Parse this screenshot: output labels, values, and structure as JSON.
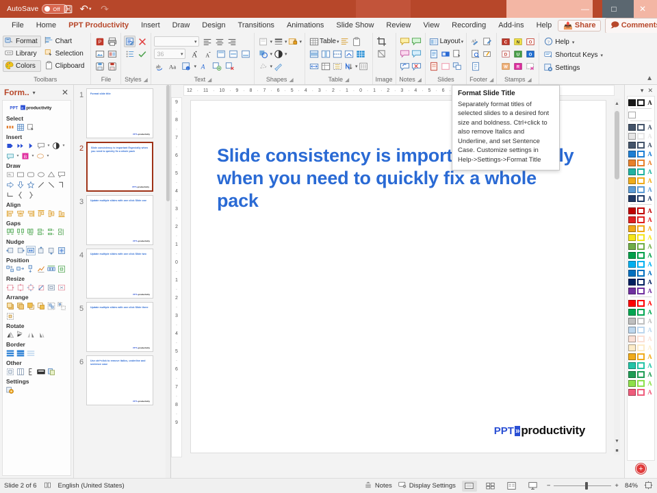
{
  "titlebar": {
    "autosave_label": "AutoSave",
    "autosave_state": "Off",
    "save_icon": "save-icon",
    "undo_icon": "undo-icon",
    "redo_icon": "redo-icon",
    "minimize": "—",
    "maximize": "□",
    "close": "✕",
    "accent_color": "#b7472a"
  },
  "tabs": [
    {
      "label": "File",
      "active": false
    },
    {
      "label": "Home",
      "active": false
    },
    {
      "label": "PPT Productivity",
      "active": true
    },
    {
      "label": "Insert",
      "active": false
    },
    {
      "label": "Draw",
      "active": false
    },
    {
      "label": "Design",
      "active": false
    },
    {
      "label": "Transitions",
      "active": false
    },
    {
      "label": "Animations",
      "active": false
    },
    {
      "label": "Slide Show",
      "active": false
    },
    {
      "label": "Review",
      "active": false
    },
    {
      "label": "View",
      "active": false
    },
    {
      "label": "Recording",
      "active": false
    },
    {
      "label": "Add-ins",
      "active": false
    },
    {
      "label": "Help",
      "active": false
    }
  ],
  "tab_actions": [
    {
      "label": "Share",
      "icon": "share-icon"
    },
    {
      "label": "Comments",
      "icon": "comment-icon"
    }
  ],
  "ribbon": {
    "groups": [
      {
        "name": "Toolbars",
        "label": "Toolbars",
        "launcher": false,
        "buttons": [
          {
            "label": "Format",
            "icon": "format-toolbar-icon",
            "selected": true
          },
          {
            "label": "Library",
            "icon": "library-icon",
            "selected": false
          },
          {
            "label": "Colors",
            "icon": "colors-palette-icon",
            "selected": true
          },
          {
            "label": "Chart",
            "icon": "chart-icon",
            "selected": false
          },
          {
            "label": "Selection",
            "icon": "selection-icon",
            "selected": false
          },
          {
            "label": "Clipboard",
            "icon": "clipboard-icon",
            "selected": false
          }
        ]
      },
      {
        "name": "File",
        "label": "File",
        "launcher": false
      },
      {
        "name": "Styles",
        "label": "Styles",
        "launcher": true
      },
      {
        "name": "Text",
        "label": "Text",
        "launcher": true,
        "font_size": "36"
      },
      {
        "name": "Shapes",
        "label": "Shapes",
        "launcher": true
      },
      {
        "name": "Table",
        "label": "Table",
        "launcher": true,
        "table_label": "Table"
      },
      {
        "name": "Image",
        "label": "Image",
        "launcher": false
      },
      {
        "name": "Notes",
        "label": "Notes",
        "launcher": true
      },
      {
        "name": "Slides",
        "label": "Slides",
        "launcher": false,
        "layout_label": "Layout"
      },
      {
        "name": "Footer",
        "label": "Footer",
        "launcher": true
      },
      {
        "name": "Stamps",
        "label": "Stamps",
        "launcher": true
      }
    ],
    "stamp_letters": [
      "C",
      "N",
      "O",
      "D",
      "U",
      "O",
      "W",
      "R",
      ""
    ],
    "help_menu": [
      {
        "label": "Help",
        "icon": "help-circle-icon",
        "caret": true
      },
      {
        "label": "Shortcut Keys",
        "icon": "shortcut-keys-icon",
        "caret": true
      },
      {
        "label": "Settings",
        "icon": "settings-gear-icon",
        "caret": false
      }
    ],
    "collapse_icon": "chevron-up-icon"
  },
  "left_panel": {
    "title": "Form..",
    "caret_icon": "chevron-down-icon",
    "close_icon": "close-icon",
    "brand": "PPT productivity",
    "sections": [
      {
        "label": "Select",
        "count": 3
      },
      {
        "label": "Insert",
        "count": 10
      },
      {
        "label": "Draw",
        "count": 15
      },
      {
        "label": "Align",
        "count": 6
      },
      {
        "label": "Gaps",
        "count": 6
      },
      {
        "label": "Nudge",
        "count": 6
      },
      {
        "label": "Position",
        "count": 6
      },
      {
        "label": "Resize",
        "count": 6
      },
      {
        "label": "Arrange",
        "count": 7
      },
      {
        "label": "Rotate",
        "count": 4
      },
      {
        "label": "Border",
        "count": 3
      },
      {
        "label": "Other",
        "count": 5
      },
      {
        "label": "Settings",
        "count": 1
      }
    ]
  },
  "thumbnails": [
    {
      "number": "1",
      "title": "Format slide title",
      "current": false
    },
    {
      "number": "2",
      "title": "Slide consistency is important Especially when you need to quickly fix a whole pack",
      "current": true
    },
    {
      "number": "3",
      "title": "Update multiple slides with one click Slide one",
      "current": false
    },
    {
      "number": "4",
      "title": "Update multiple slides with one click Slide two",
      "current": false
    },
    {
      "number": "5",
      "title": "Update multiple slides with one click Slide three",
      "current": false
    },
    {
      "number": "6",
      "title": "Use ctrl+click to remove italics, underline and sentence case",
      "current": false
    }
  ],
  "slide": {
    "title": "Slide consistency is important Especially when you need to quickly fix a whole pack",
    "logo_ppt": "PPT",
    "logo_chevron": "»",
    "logo_word": "productivity",
    "title_color": "#2a6ad4"
  },
  "ruler": {
    "horizontal": [
      "12",
      "11",
      "10",
      "9",
      "8",
      "7",
      "6",
      "5",
      "4",
      "3",
      "2",
      "1",
      "0",
      "1",
      "2",
      "3",
      "4",
      "5",
      "6",
      "7",
      "8",
      "9",
      "10",
      "11",
      "12"
    ],
    "vertical": [
      "9",
      "8",
      "7",
      "6",
      "5",
      "4",
      "3",
      "2",
      "1",
      "0",
      "1",
      "2",
      "3",
      "4",
      "5",
      "6",
      "7",
      "8",
      "9"
    ]
  },
  "tooltip": {
    "title": "Format Slide Title",
    "body": "Separately format titles of selected slides to a desired font size and boldness. Ctrl+click to also remove Italics and Underline, and set Sentence Case. Customize settings in Help->Settings->Format Title"
  },
  "color_panel": {
    "caret_icon": "chevron-down-icon",
    "close_icon": "close-icon",
    "add_label": "+",
    "groups": [
      {
        "colors": [
          "#1a1a1a"
        ]
      },
      {
        "colors": [
          "#ffffff"
        ]
      },
      {
        "colors": [
          "#44546a",
          "#e7e6e6",
          "#44546a",
          "#1f7fd4",
          "#e8802a",
          "#20b2a0",
          "#f0ac1a",
          "#5b9bd5",
          "#1f3864"
        ]
      },
      {
        "colors": [
          "#c00000",
          "#e02020",
          "#f0a818",
          "#f5e61a",
          "#70ad47",
          "#00a04a",
          "#00b0f0",
          "#0070c0",
          "#002060",
          "#7030a0"
        ]
      },
      {
        "colors": [
          "#ff0000",
          "#00a651",
          "#bfbfbf",
          "#bdd7ee",
          "#fbe0d5",
          "#fdecc8",
          "#f0ab1a",
          "#23c4a7",
          "#1f9d55",
          "#8de04a",
          "#ef5b7b"
        ]
      }
    ]
  },
  "statusbar": {
    "slide_counter": "Slide 2 of 6",
    "accessibility_icon": "book-icon",
    "language": "English (United States)",
    "notes_label": "Notes",
    "notes_icon": "notes-icon",
    "display_settings_label": "Display Settings",
    "display_settings_icon": "display-settings-icon",
    "views": [
      {
        "icon": "normal-view-icon",
        "active": true
      },
      {
        "icon": "slide-sorter-icon",
        "active": false
      },
      {
        "icon": "reading-view-icon",
        "active": false
      },
      {
        "icon": "slideshow-icon",
        "active": false
      }
    ],
    "zoom_out": "−",
    "zoom_in": "+",
    "zoom_level": "84%",
    "fit_icon": "fit-slide-icon"
  }
}
